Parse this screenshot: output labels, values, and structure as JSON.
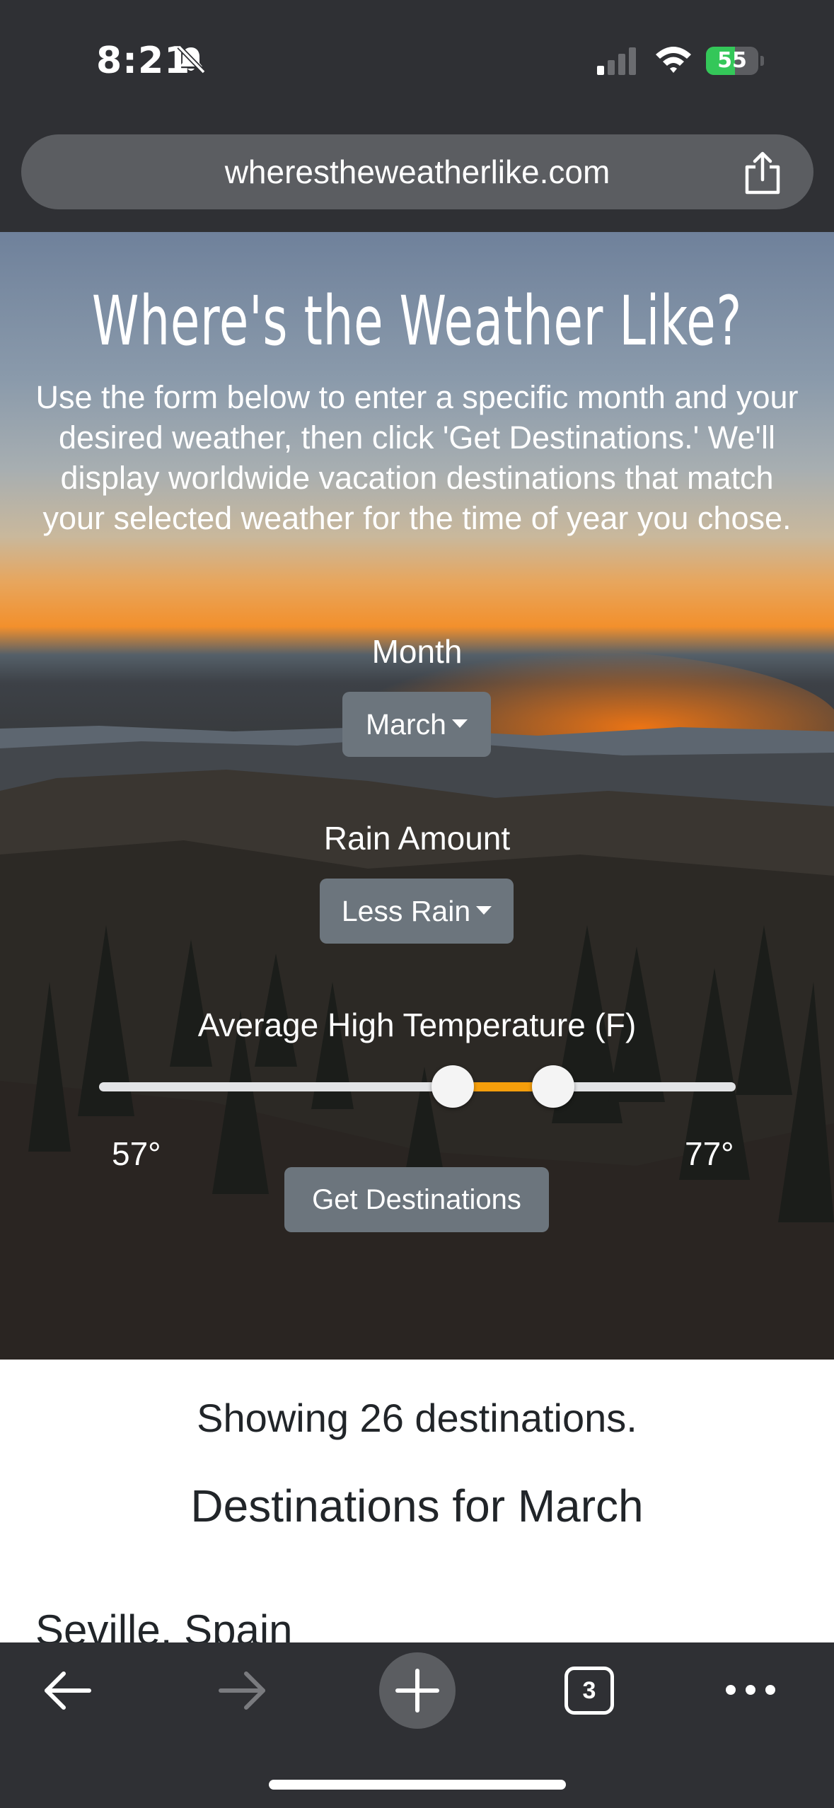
{
  "status": {
    "time": "8:21",
    "battery": "55",
    "battery_level": 0.55
  },
  "browser": {
    "url": "wherestheweatherlike.com",
    "tab_count": "3"
  },
  "hero": {
    "title": "Where's the Weather Like?",
    "description": "Use the form below to enter a specific month and your desired weather, then click 'Get Destinations.' We'll display worldwide vacation destinations that match your selected weather for the time of year you chose."
  },
  "form": {
    "month_label": "Month",
    "month_value": "March",
    "rain_label": "Rain Amount",
    "rain_value": "Less Rain",
    "temp_label": "Average High Temperature (F)",
    "temp_min_label": "57°",
    "temp_max_label": "77°",
    "temp_min": 57,
    "temp_max": 77,
    "thumb_low_fraction": 0.555,
    "thumb_high_fraction": 0.713,
    "submit_label": "Get Destinations"
  },
  "results": {
    "count_text": "Showing 26 destinations.",
    "heading": "Destinations for March",
    "first_destination": "Seville, Spain"
  },
  "colors": {
    "accent": "#f59e0b",
    "button": "#6c757d",
    "battery": "#34c759"
  }
}
